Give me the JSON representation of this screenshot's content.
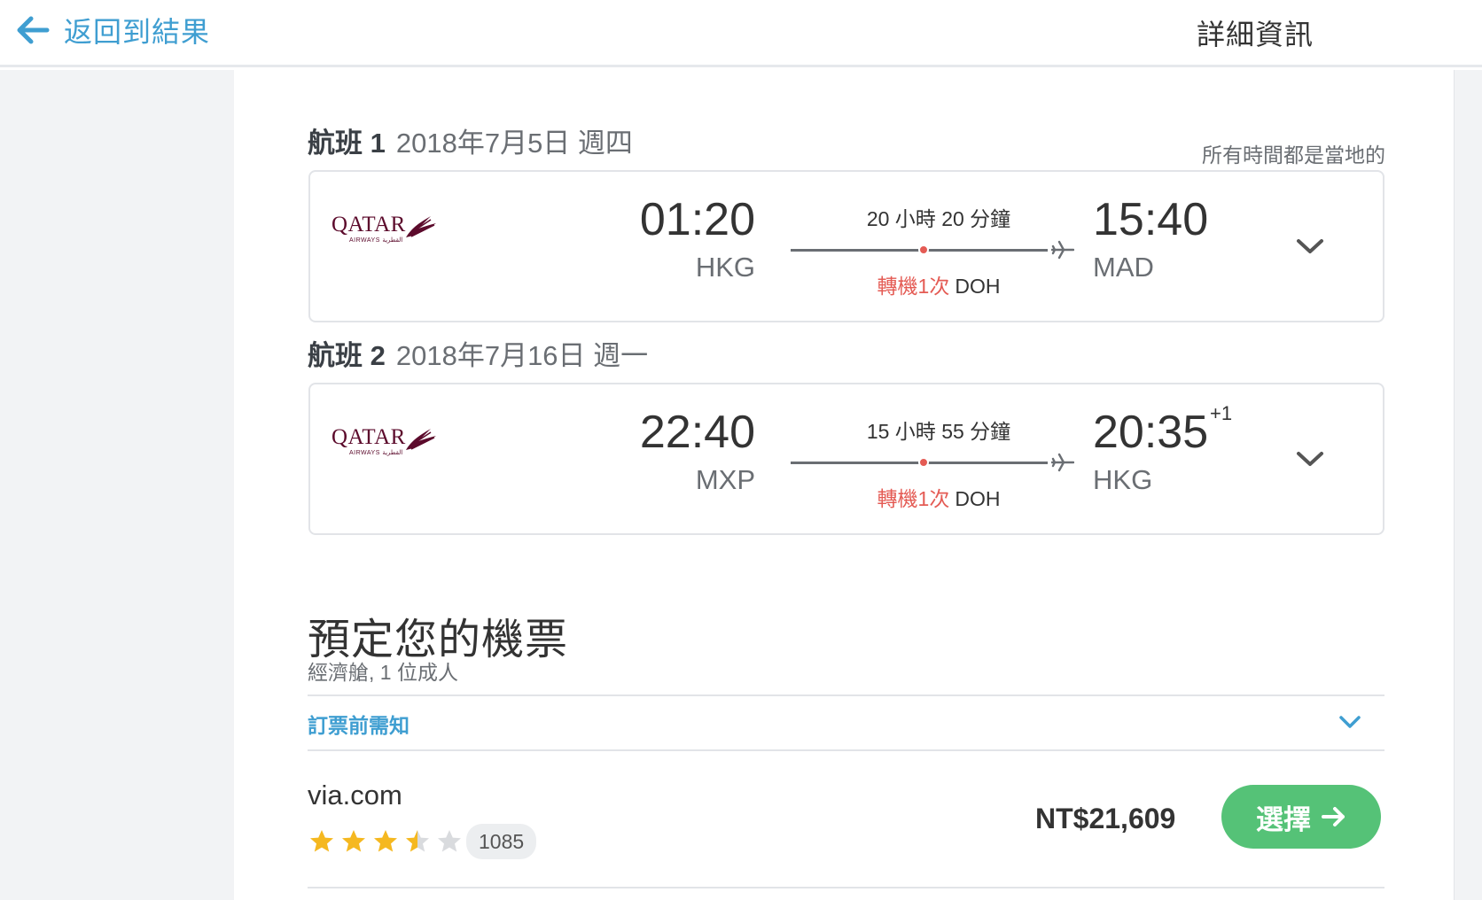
{
  "header": {
    "back_label": "返回到結果",
    "title": "詳細資訊",
    "back_icon": "arrow-left-icon"
  },
  "colors": {
    "link_blue": "#3f9ed1",
    "stop_red": "#e45b54",
    "select_green": "#55c277",
    "star_gold": "#f5b820",
    "star_empty": "#d9dbde",
    "airline_maroon": "#5c0b2c"
  },
  "local_time_note": "所有時間都是當地的",
  "legs": [
    {
      "label": "航班 1",
      "date": "2018年7月5日 週四",
      "airline": "QATAR",
      "airline_sub": "AIRWAYS القطرية",
      "dep_time": "01:20",
      "dep_code": "HKG",
      "duration": "20 小時 20 分鐘",
      "stops": "轉機1次",
      "stop_code": "DOH",
      "arr_time": "15:40",
      "arr_code": "MAD",
      "arr_day_offset": ""
    },
    {
      "label": "航班 2",
      "date": "2018年7月16日 週一",
      "airline": "QATAR",
      "airline_sub": "AIRWAYS القطرية",
      "dep_time": "22:40",
      "dep_code": "MXP",
      "duration": "15 小時 55 分鐘",
      "stops": "轉機1次",
      "stop_code": "DOH",
      "arr_time": "20:35",
      "arr_code": "HKG",
      "arr_day_offset": "+1"
    }
  ],
  "booking": {
    "title": "預定您的機票",
    "subtitle": "經濟艙, 1 位成人",
    "notice_label": "訂票前需知",
    "provider": "via.com",
    "rating": 3.5,
    "rating_max": 5,
    "review_count": "1085",
    "price": "NT$21,609",
    "select_label": "選擇"
  }
}
